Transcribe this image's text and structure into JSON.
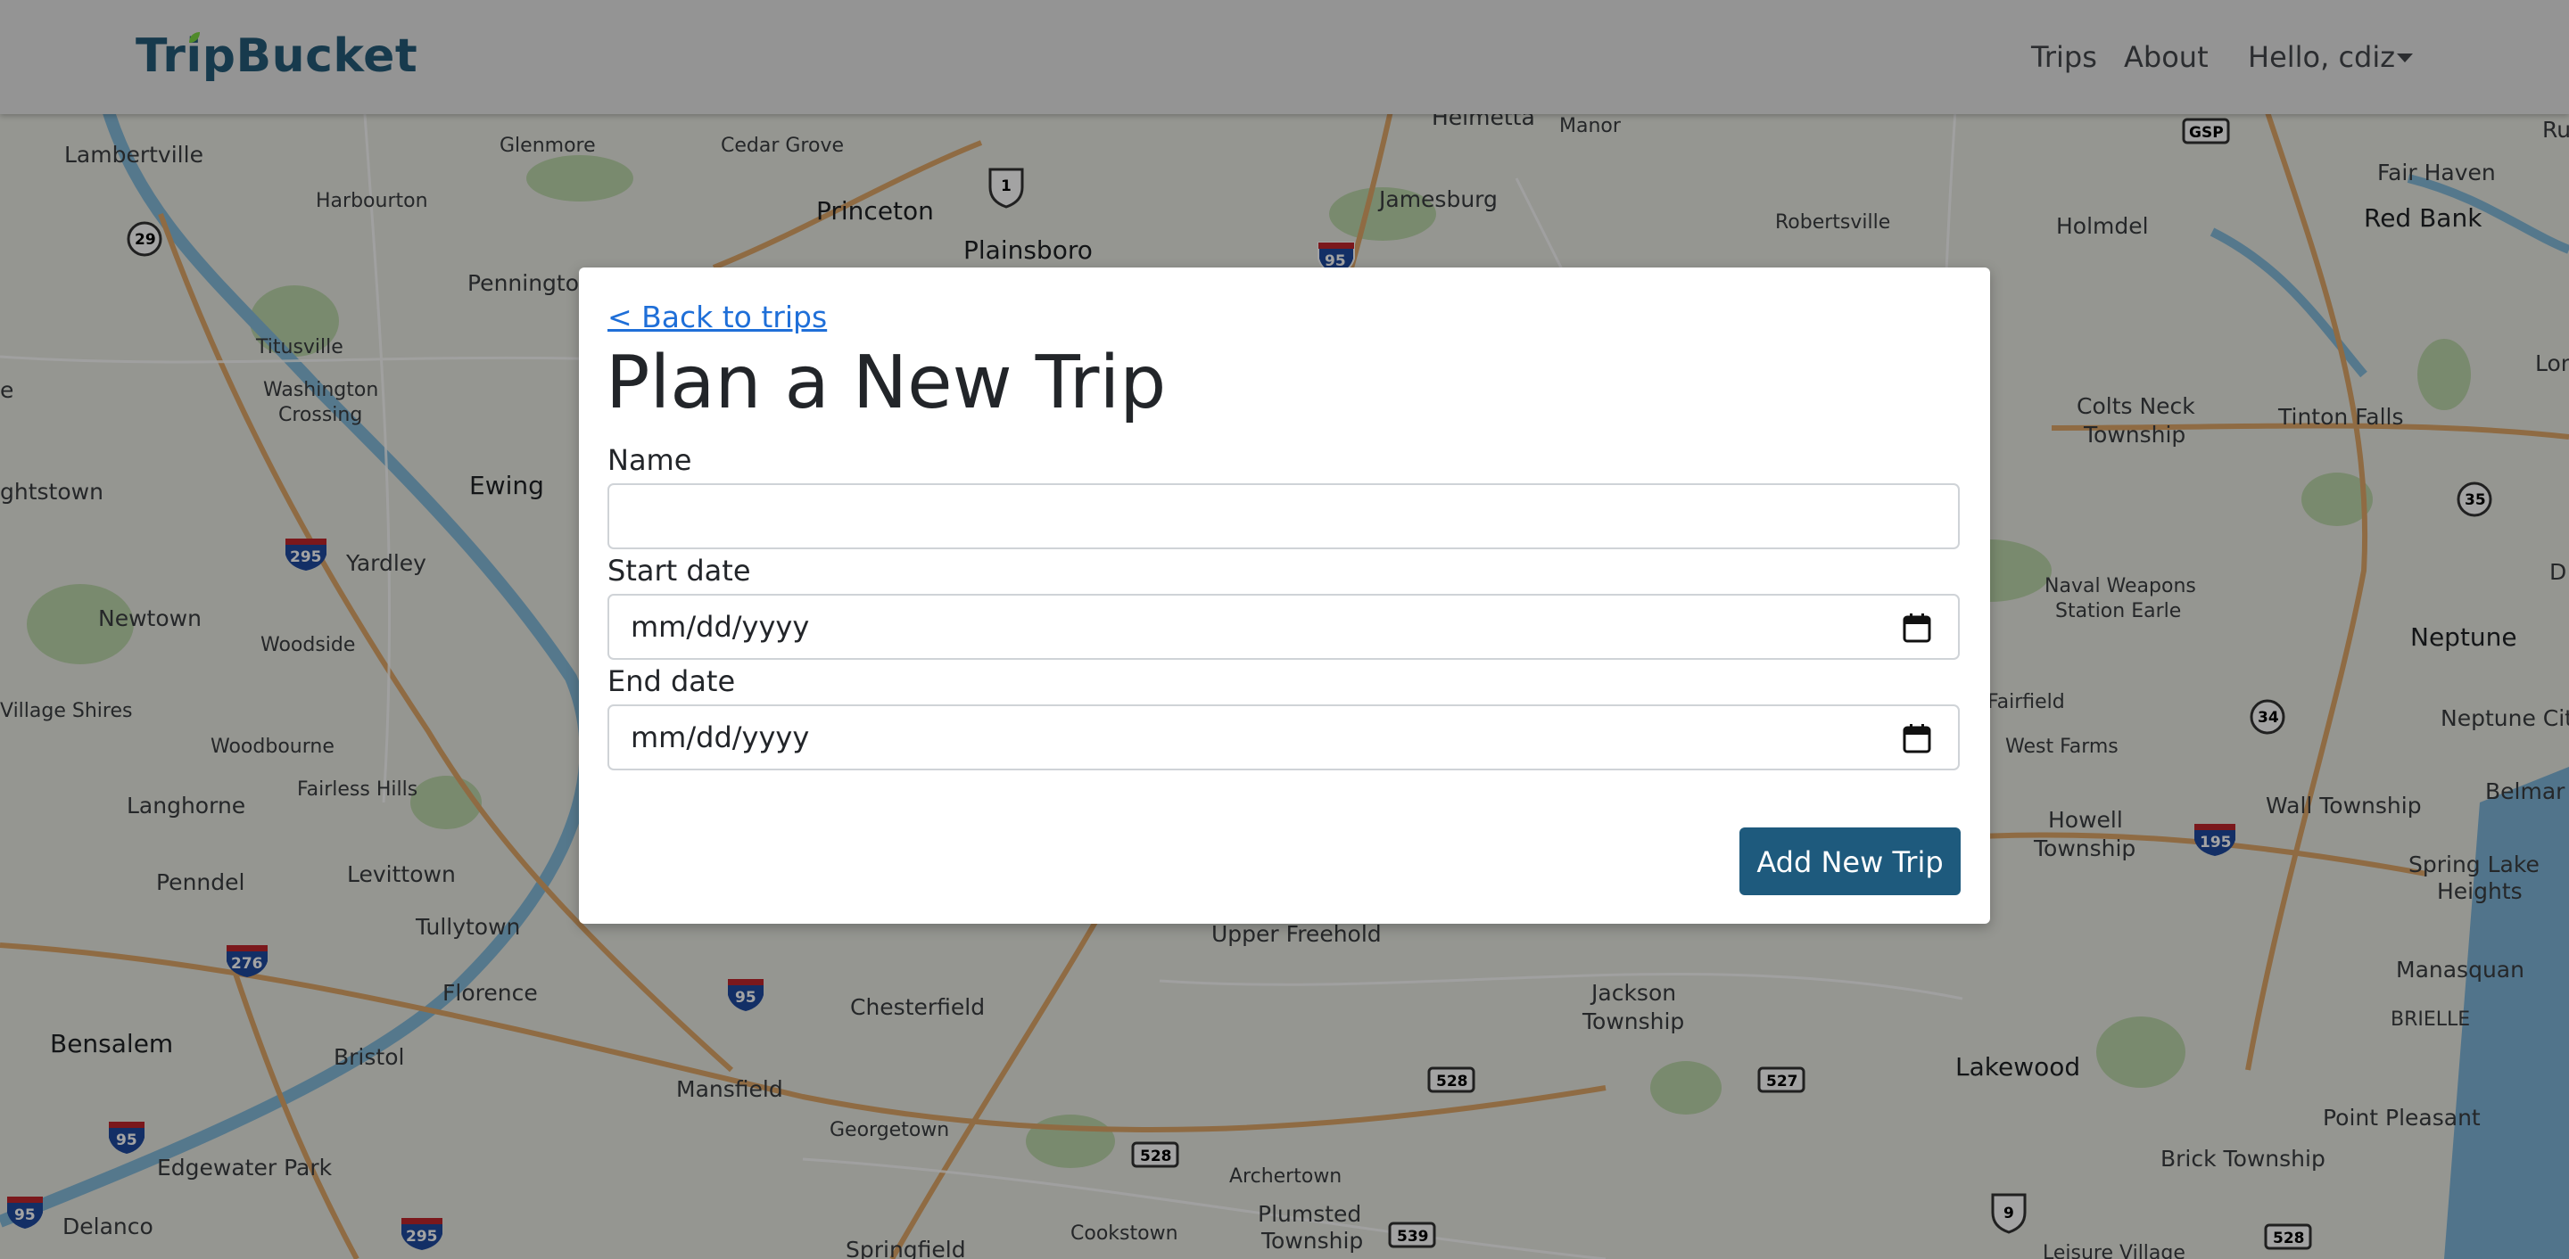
{
  "navbar": {
    "brand": "TripBucket",
    "links": {
      "trips": "Trips",
      "about": "About"
    },
    "user_menu": "Hello, cdiz"
  },
  "modal": {
    "back_link": "< Back to trips",
    "title": "Plan a New Trip",
    "fields": {
      "name": {
        "label": "Name",
        "value": ""
      },
      "start_date": {
        "label": "Start date",
        "placeholder": "mm/dd/yyyy"
      },
      "end_date": {
        "label": "End date",
        "placeholder": "mm/dd/yyyy"
      }
    },
    "submit_label": "Add New Trip"
  },
  "map": {
    "labels": {
      "helmetta": "Helmetta",
      "manor": "Manor",
      "lambertville": "Lambertville",
      "glenmore": "Glenmore",
      "cedar_grove": "Cedar Grove",
      "harbourton": "Harbourton",
      "princeton": "Princeton",
      "plainsboro": "Plainsboro",
      "jamesburg": "Jamesburg",
      "robertsville": "Robertsville",
      "holmdel": "Holmdel",
      "fair_haven": "Fair Haven",
      "red_bank": "Red Bank",
      "pennington": "Pennington",
      "titusville": "Titusville",
      "washington_crossing_1": "Washington",
      "washington_crossing_2": "Crossing",
      "ewing": "Ewing",
      "ightstown": "ghtstown",
      "yardley": "Yardley",
      "newtown": "Newtown",
      "woodside": "Woodside",
      "village_shires": "Village Shires",
      "woodbourne": "Woodbourne",
      "fairless_hills": "Fairless Hills",
      "langhorne": "Langhorne",
      "levittown": "Levittown",
      "penndel": "Penndel",
      "tullytown": "Tullytown",
      "florence": "Florence",
      "bensalem": "Bensalem",
      "bristol": "Bristol",
      "edgewater_park": "Edgewater Park",
      "delanco": "Delanco",
      "mansfield": "Mansfield",
      "georgetown": "Georgetown",
      "chesterfield": "Chesterfield",
      "upper_freehold": "Upper Freehold",
      "archertown": "Archertown",
      "cookstown": "Cookstown",
      "springfield": "Springfield",
      "plumsted_1": "Plumsted",
      "plumsted_2": "Township",
      "jackson_1": "Jackson",
      "jackson_2": "Township",
      "lakewood": "Lakewood",
      "colts_neck_1": "Colts Neck",
      "colts_neck_2": "Township",
      "tinton_falls": "Tinton Falls",
      "naval_1": "Naval Weapons",
      "naval_2": "Station Earle",
      "neptune": "Neptune",
      "neptune_city": "Neptune Cit",
      "fairfield": "Fairfield",
      "west_farms": "West Farms",
      "howell_1": "Howell",
      "howell_2": "Township",
      "wall_township": "Wall Township",
      "belmar": "Belmar",
      "spring_lake_1": "Spring Lake",
      "spring_lake_2": "Heights",
      "manasquan": "Manasquan",
      "brielle": "BRIELLE",
      "point_pleasant": "Point Pleasant",
      "brick_township": "Brick Township",
      "leisure_village": "Leisure Village",
      "lon": "Lon",
      "d": "D",
      "ru": "Ru",
      "e": "e"
    },
    "shields": {
      "us1": "1",
      "nj29": "29",
      "i95_top": "95",
      "gsp": "GSP",
      "i295_left": "295",
      "nj35": "35",
      "nj34": "34",
      "i195": "195",
      "i276": "276",
      "i95_mid": "95",
      "i95_left": "95",
      "i95_bl": "95",
      "i295_bottom": "295",
      "cr528_a": "528",
      "cr528_b": "528",
      "cr527": "527",
      "cr539": "539",
      "us9": "9",
      "cr528_c": "528"
    }
  }
}
